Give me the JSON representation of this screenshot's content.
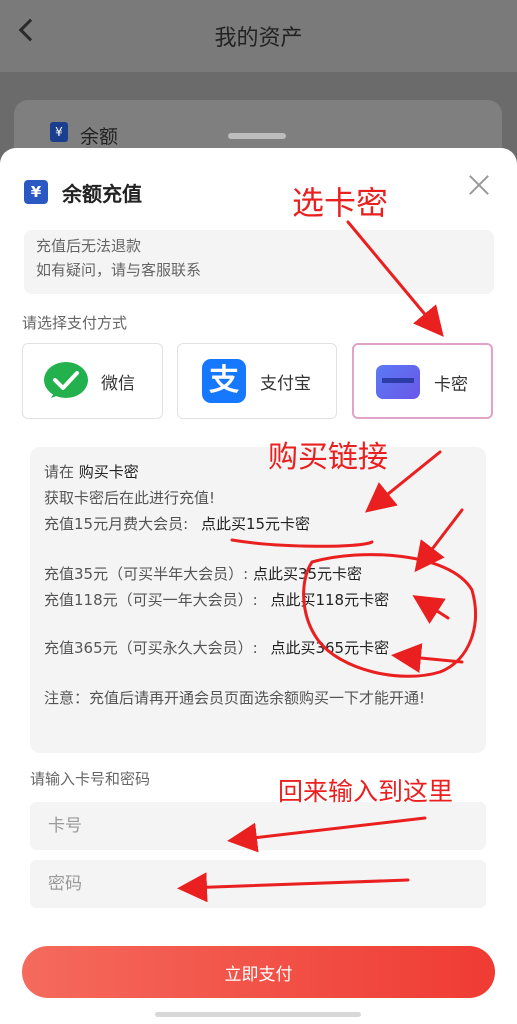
{
  "page": {
    "title": "我的资产",
    "card_label": "余额",
    "card_icon": "¥"
  },
  "sheet": {
    "title_icon": "¥",
    "title": "余额充值",
    "notice_line1": "充值后无法退款",
    "notice_line2": "如有疑问，请与客服联系",
    "payment_label": "请选择支付方式",
    "payment_options": [
      {
        "label": "微信",
        "icon": "wechat-icon"
      },
      {
        "label": "支付宝",
        "icon": "alipay-icon",
        "glyph": "支"
      },
      {
        "label": "卡密",
        "icon": "card-icon",
        "selected": true
      }
    ],
    "info": {
      "line1_prefix": "请在",
      "line1_link": "购买卡密",
      "line2": "获取卡密后在此进行充值!",
      "line3_text": "充值15元月费大会员:",
      "line3_link": "点此买15元卡密",
      "line4_text": "充值35元（可买半年大会员）:",
      "line4_link": "点此买35元卡密",
      "line5_text": "充值118元（可买一年大会员）:",
      "line5_link": "点此买118元卡密",
      "line6_text": "充值365元（可买永久大会员）:",
      "line6_link": "点此买365元卡密",
      "note": "注意：充值后请再开通会员页面选余额购买一下才能开通!"
    },
    "input_label": "请输入卡号和密码",
    "card_number_placeholder": "卡号",
    "password_placeholder": "密码",
    "pay_button": "立即支付"
  },
  "annotations": {
    "select_card": "选卡密",
    "buy_link": "购买链接",
    "come_back": "回来输入到这里"
  },
  "colors": {
    "accent_red": "#ef3b33",
    "annotation_red": "#ea1f1f",
    "selected_border": "#e1a3c8",
    "wechat_green": "#22b14c",
    "alipay_blue": "#1677ff"
  }
}
